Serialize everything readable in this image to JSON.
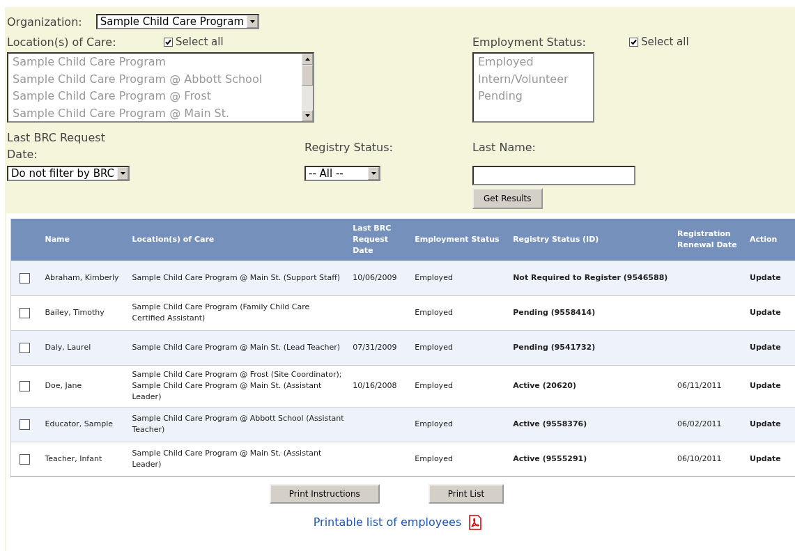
{
  "filters": {
    "organization": {
      "label": "Organization:",
      "value": "Sample Child Care Program"
    },
    "locations": {
      "label": "Location(s) of Care:",
      "select_all": {
        "label": "Select all",
        "checked": true
      },
      "disabled": true,
      "items": [
        "Sample Child Care Program",
        "Sample Child Care Program @ Abbott School",
        "Sample Child Care Program @ Frost",
        "Sample Child Care Program @ Main St."
      ]
    },
    "employment_status": {
      "label": "Employment Status:",
      "select_all": {
        "label": "Select all",
        "checked": true
      },
      "disabled": true,
      "items": [
        "Employed",
        "Intern/Volunteer",
        "Pending"
      ]
    },
    "last_brc": {
      "label": "Last BRC Request Date:",
      "value": "Do not filter by BRC"
    },
    "registry_status": {
      "label": "Registry Status:",
      "value": "-- All --"
    },
    "last_name": {
      "label": "Last Name:"
    },
    "get_results": "Get Results"
  },
  "table": {
    "columns": [
      "Name",
      "Location(s) of Care",
      "Last BRC Request Date",
      "Employment Status",
      "Registry Status (ID)",
      "Registration Renewal Date",
      "Action"
    ],
    "rows": [
      {
        "checked": false,
        "name": "Abraham, Kimberly",
        "location": "Sample Child Care Program @ Main St. (Support Staff)",
        "last_brc": "10/06/2009",
        "employment": "Employed",
        "registry": "Not Required to Register (9546588)",
        "renewal": "",
        "action": "Update"
      },
      {
        "checked": false,
        "name": "Bailey, Timothy",
        "location": "Sample Child Care Program (Family Child Care Certified Assistant)",
        "last_brc": "",
        "employment": "Employed",
        "registry": "Pending (9558414)",
        "renewal": "",
        "action": "Update"
      },
      {
        "checked": false,
        "name": "Daly, Laurel",
        "location": "Sample Child Care Program @ Main St. (Lead Teacher)",
        "last_brc": "07/31/2009",
        "employment": "Employed",
        "registry": "Pending (9541732)",
        "renewal": "",
        "action": "Update"
      },
      {
        "checked": false,
        "name": "Doe, Jane",
        "location": "Sample Child Care Program @ Frost (Site Coordinator); Sample Child Care Program @ Main St. (Assistant Leader)",
        "last_brc": "10/16/2008",
        "employment": "Employed",
        "registry": "Active (20620)",
        "renewal": "06/11/2011",
        "action": "Update"
      },
      {
        "checked": false,
        "name": "Educator, Sample",
        "location": "Sample Child Care Program @ Abbott School (Assistant Teacher)",
        "last_brc": "",
        "employment": "Employed",
        "registry": "Active (9558376)",
        "renewal": "06/02/2011",
        "action": "Update"
      },
      {
        "checked": false,
        "name": "Teacher, Infant",
        "location": "Sample Child Care Program @ Main St. (Assistant Leader)",
        "last_brc": "",
        "employment": "Employed",
        "registry": "Active (9555291)",
        "renewal": "06/10/2011",
        "action": "Update"
      }
    ]
  },
  "buttons": [
    "Print Instructions",
    "Print List"
  ],
  "printable_link": "Printable list of employees"
}
